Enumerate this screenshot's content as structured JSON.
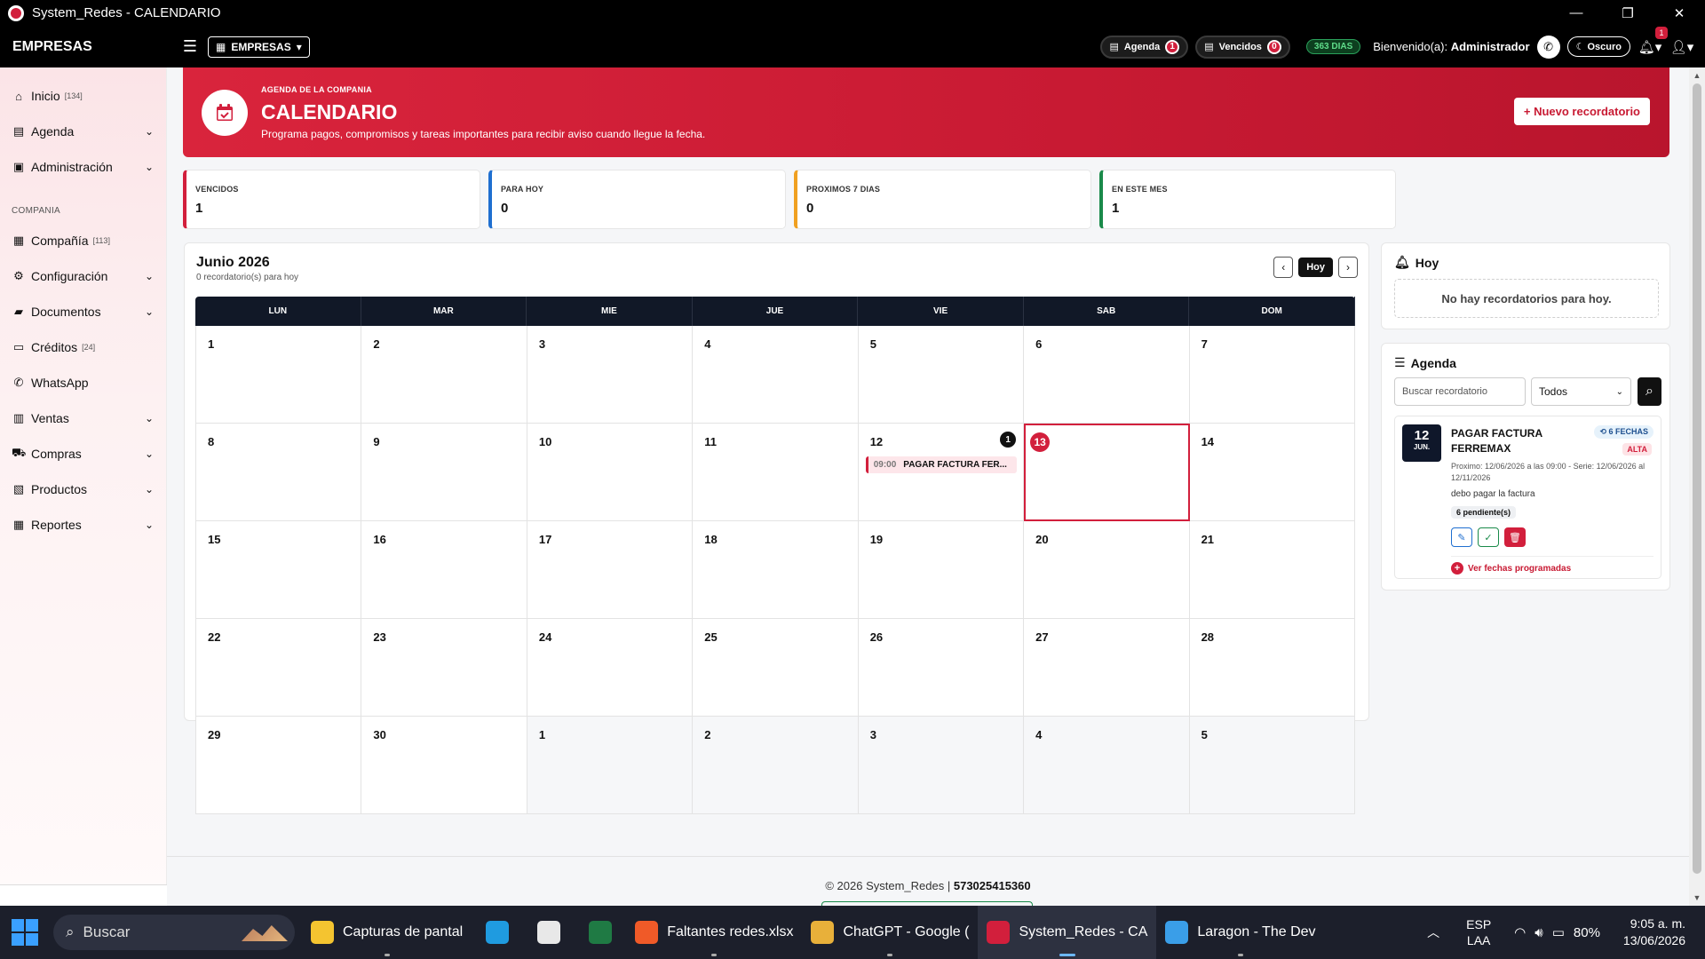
{
  "window": {
    "title": "System_Redes - CALENDARIO",
    "minimize": "—",
    "maximize": "❐",
    "close": "✕"
  },
  "navbar": {
    "brand": "EMPRESAS",
    "menu_icon": "hamburger-icon",
    "company_button": "EMPRESAS",
    "agenda_label": "Agenda",
    "agenda_count": "1",
    "vencidos_label": "Vencidos",
    "vencidos_count": "0",
    "days_badge": "363 DIAS",
    "welcome_prefix": "Bienvenido(a):",
    "welcome_user": "Administrador",
    "theme_button": "Oscuro",
    "notif_count": "1"
  },
  "sidebar": {
    "items_top": [
      {
        "label": "Inicio",
        "badge": "[134]",
        "icon": "home-icon",
        "chevron": false
      },
      {
        "label": "Agenda",
        "badge": "",
        "icon": "calendar-icon",
        "chevron": true
      },
      {
        "label": "Administración",
        "badge": "",
        "icon": "id-card-icon",
        "chevron": true
      }
    ],
    "section_label": "COMPANIA",
    "items_company": [
      {
        "label": "Compañía",
        "badge": "[113]",
        "icon": "building-icon",
        "chevron": false
      },
      {
        "label": "Configuración",
        "badge": "",
        "icon": "gears-icon",
        "chevron": true
      },
      {
        "label": "Documentos",
        "badge": "",
        "icon": "folder-icon",
        "chevron": true
      },
      {
        "label": "Créditos",
        "badge": "[24]",
        "icon": "credit-card-icon",
        "chevron": false
      },
      {
        "label": "WhatsApp",
        "badge": "",
        "icon": "whatsapp-icon",
        "chevron": false
      },
      {
        "label": "Ventas",
        "badge": "",
        "icon": "cash-icon",
        "chevron": true
      },
      {
        "label": "Compras",
        "badge": "",
        "icon": "cart-icon",
        "chevron": true
      },
      {
        "label": "Productos",
        "badge": "",
        "icon": "boxes-icon",
        "chevron": true
      },
      {
        "label": "Reportes",
        "badge": "",
        "icon": "chart-icon",
        "chevron": true
      }
    ]
  },
  "hero": {
    "kicker": "AGENDA DE LA COMPANIA",
    "title": "CALENDARIO",
    "subtitle": "Programa pagos, compromisos y tareas importantes para recibir aviso cuando llegue la fecha.",
    "new_button": "+ Nuevo recordatorio"
  },
  "stats": [
    {
      "label": "VENCIDOS",
      "value": "1",
      "color": "#d21f3c"
    },
    {
      "label": "PARA HOY",
      "value": "0",
      "color": "#1f6fd0"
    },
    {
      "label": "PROXIMOS 7 DIAS",
      "value": "0",
      "color": "#f0a020"
    },
    {
      "label": "EN ESTE MES",
      "value": "1",
      "color": "#1a8a4a"
    }
  ],
  "calendar": {
    "month_title": "Junio 2026",
    "subtitle": "0 recordatorio(s) para hoy",
    "today_button": "Hoy",
    "weekdays": [
      "LUN",
      "MAR",
      "MIE",
      "JUE",
      "VIE",
      "SAB",
      "DOM"
    ],
    "days": [
      {
        "n": "1"
      },
      {
        "n": "2"
      },
      {
        "n": "3"
      },
      {
        "n": "4"
      },
      {
        "n": "5"
      },
      {
        "n": "6"
      },
      {
        "n": "7"
      },
      {
        "n": "8"
      },
      {
        "n": "9"
      },
      {
        "n": "10"
      },
      {
        "n": "11"
      },
      {
        "n": "12",
        "count": "1",
        "event_time": "09:00",
        "event_name": "PAGAR FACTURA FER..."
      },
      {
        "n": "13",
        "today": true
      },
      {
        "n": "14"
      },
      {
        "n": "15"
      },
      {
        "n": "16"
      },
      {
        "n": "17"
      },
      {
        "n": "18"
      },
      {
        "n": "19"
      },
      {
        "n": "20"
      },
      {
        "n": "21"
      },
      {
        "n": "22"
      },
      {
        "n": "23"
      },
      {
        "n": "24"
      },
      {
        "n": "25"
      },
      {
        "n": "26"
      },
      {
        "n": "27"
      },
      {
        "n": "28"
      },
      {
        "n": "29"
      },
      {
        "n": "30"
      },
      {
        "n": "1",
        "out": true
      },
      {
        "n": "2",
        "out": true
      },
      {
        "n": "3",
        "out": true
      },
      {
        "n": "4",
        "out": true
      },
      {
        "n": "5",
        "out": true
      }
    ]
  },
  "hoy": {
    "title": "Hoy",
    "empty": "No hay recordatorios para hoy."
  },
  "agenda": {
    "title": "Agenda",
    "search_placeholder": "Buscar recordatorio",
    "filter_value": "Todos",
    "reminder": {
      "day": "12",
      "month": "JUN.",
      "title": "PAGAR FACTURA FERREMAX",
      "fechas": "6 FECHAS",
      "priority": "ALTA",
      "meta": "Proximo: 12/06/2026 a las 09:00 - Serie: 12/06/2026 al 12/11/2026",
      "note": "debo pagar la factura",
      "pending": "6 pendiente(s)",
      "link": "Ver fechas programadas"
    }
  },
  "footer": {
    "copyright": "© 2026 System_Redes |",
    "phone": "573025415360"
  },
  "taskbar": {
    "search": "Buscar",
    "apps": [
      {
        "label": "Capturas de pantal",
        "color": "#f4c430",
        "state": "run"
      },
      {
        "label": "",
        "color": "#1f9be0",
        "state": "none"
      },
      {
        "label": "",
        "color": "#e8e8e8",
        "state": "none"
      },
      {
        "label": "",
        "color": "#1f7a44",
        "state": "none"
      },
      {
        "label": "Faltantes redes.xlsx",
        "color": "#f05a28",
        "state": "run"
      },
      {
        "label": "ChatGPT - Google (",
        "color": "#e8b03a",
        "state": "run"
      },
      {
        "label": "System_Redes - CA",
        "color": "#d21f3c",
        "state": "active"
      },
      {
        "label": "Laragon - The Dev",
        "color": "#3a9ee8",
        "state": "run"
      }
    ],
    "lang_top": "ESP",
    "lang_bottom": "LAA",
    "battery": "80%",
    "time": "9:05 a. m.",
    "date": "13/06/2026"
  }
}
